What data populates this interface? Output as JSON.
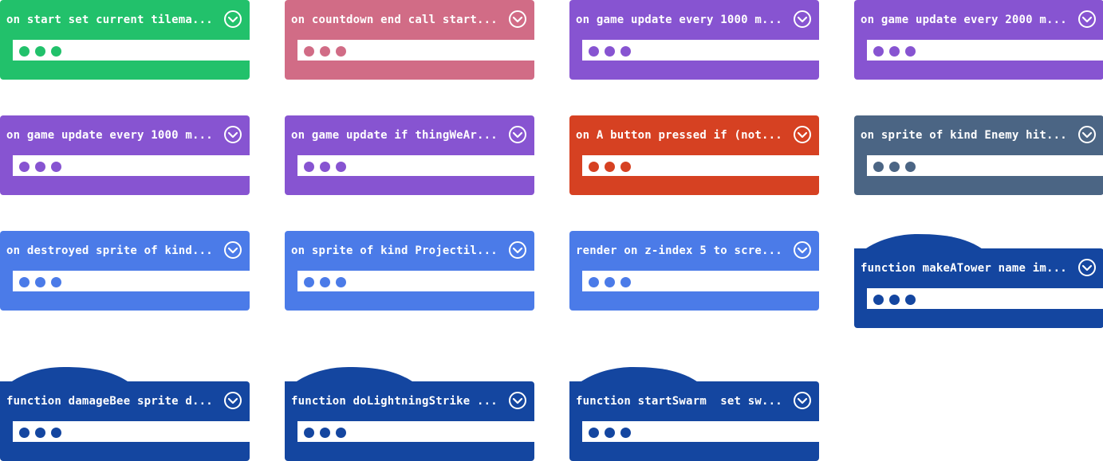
{
  "colors": {
    "green": "#22c16b",
    "pink": "#d16c86",
    "purple": "#8754d1",
    "red": "#d64122",
    "slate": "#4b6584",
    "blue": "#4b7be8",
    "navy": "#1446a0"
  },
  "blocks": [
    {
      "title": "on start set current tilema...",
      "color": "green",
      "hat": false,
      "col": 0,
      "row": 0
    },
    {
      "title": "on countdown end call start...",
      "color": "pink",
      "hat": false,
      "col": 1,
      "row": 0
    },
    {
      "title": "on game update every 1000 m...",
      "color": "purple",
      "hat": false,
      "col": 2,
      "row": 0
    },
    {
      "title": "on game update every 2000 m...",
      "color": "purple",
      "hat": false,
      "col": 3,
      "row": 0
    },
    {
      "title": "on game update every 1000 m...",
      "color": "purple",
      "hat": false,
      "col": 0,
      "row": 1
    },
    {
      "title": "on game update if thingWeAr...",
      "color": "purple",
      "hat": false,
      "col": 1,
      "row": 1
    },
    {
      "title": "on A button pressed if (not...",
      "color": "red",
      "hat": false,
      "col": 2,
      "row": 1
    },
    {
      "title": "on sprite of kind Enemy hit...",
      "color": "slate",
      "hat": false,
      "col": 3,
      "row": 1
    },
    {
      "title": "on destroyed sprite of kind...",
      "color": "blue",
      "hat": false,
      "col": 0,
      "row": 2
    },
    {
      "title": "on sprite of kind Projectil...",
      "color": "blue",
      "hat": false,
      "col": 1,
      "row": 2
    },
    {
      "title": "render on z-index 5 to scre...",
      "color": "blue",
      "hat": false,
      "col": 2,
      "row": 2
    },
    {
      "title": "function makeATower name im...",
      "color": "navy",
      "hat": true,
      "col": 3,
      "row": 2
    },
    {
      "title": "function damageBee sprite d...",
      "color": "navy",
      "hat": true,
      "col": 0,
      "row": 3
    },
    {
      "title": "function doLightningStrike ...",
      "color": "navy",
      "hat": true,
      "col": 1,
      "row": 3
    },
    {
      "title": "function startSwarm  set sw...",
      "color": "navy",
      "hat": true,
      "col": 2,
      "row": 3
    }
  ],
  "icons": {
    "collapse": "chevron-down-circle-icon",
    "more": "ellipsis-dots-icon"
  }
}
